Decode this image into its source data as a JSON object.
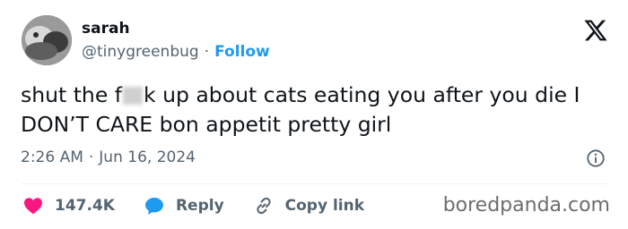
{
  "author": {
    "name": "sarah",
    "handle": "@tinygreenbug",
    "separator": "·",
    "follow_label": "Follow"
  },
  "tweet": {
    "text_before": "shut the f",
    "text_after": "k up about cats eating you after you die I DON’T CARE bon appetit pretty girl"
  },
  "meta": {
    "time": "2:26 AM",
    "separator": "·",
    "date": "Jun 16, 2024"
  },
  "actions": {
    "like_count": "147.4K",
    "reply_label": "Reply",
    "copy_link_label": "Copy link"
  },
  "watermark": "boredpanda.com",
  "colors": {
    "accent": "#1d9bf0",
    "like": "#f91880",
    "text": "#0f1419",
    "muted": "#536471"
  },
  "icons": [
    "x-logo-icon",
    "info-icon",
    "heart-icon",
    "reply-bubble-icon",
    "link-icon"
  ]
}
